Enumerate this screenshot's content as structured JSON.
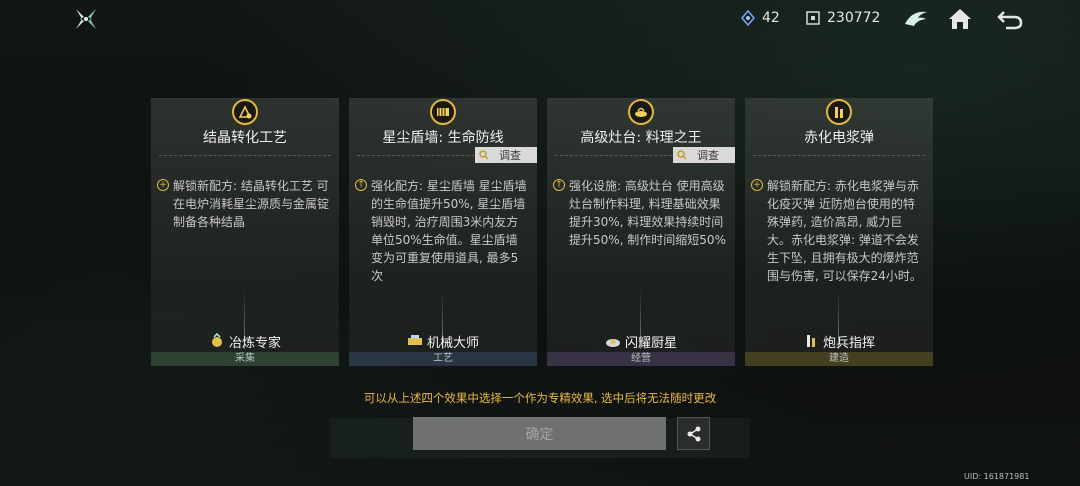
{
  "top_bar": {
    "crystal_count": "42",
    "coin_count": "230772",
    "icons": [
      "logo-icon",
      "crystal-icon",
      "coin-icon",
      "wing-icon",
      "home-icon",
      "back-icon"
    ]
  },
  "cards": [
    {
      "title": "结晶转化工艺",
      "emblem": "crystal-process-icon",
      "description": "解锁新配方: 结晶转化工艺 可在电炉消耗星尘源质与金属锭制备各种结晶",
      "specialty": "冶炼专家",
      "category": "采集"
    },
    {
      "title": "星尘盾墙: 生命防线",
      "emblem": "shield-wall-icon",
      "inspect_label": "调查",
      "description": "强化配方: 星尘盾墙 星尘盾墙的生命值提升50%, 星尘盾墙销毁时, 治疗周围3米内友方单位50%生命值。星尘盾墙变为可重复使用道具, 最多5次",
      "specialty": "机械大师",
      "category": "工艺"
    },
    {
      "title": "高级灶台: 料理之王",
      "emblem": "stove-icon",
      "inspect_label": "调查",
      "description": "强化设施: 高级灶台 使用高级灶台制作料理, 料理基础效果提升30%, 料理效果持续时间提升50%, 制作时间缩短50%",
      "specialty": "闪耀厨星",
      "category": "经营"
    },
    {
      "title": "赤化电浆弹",
      "emblem": "plasma-shell-icon",
      "description": "解锁新配方: 赤化电浆弹与赤化疫灭弹 近防炮台使用的特殊弹药, 造价高昂, 威力巨大。赤化电浆弹: 弹道不会发生下坠, 且拥有极大的爆炸范围与伤害, 可以保存24小时。",
      "specialty": "炮兵指挥",
      "category": "建造"
    }
  ],
  "hint": "可以从上述四个效果中选择一个作为专精效果, 选中后将无法随时更改",
  "confirm_label": "确定",
  "uid": "UID: 161871981",
  "colors": {
    "accent": "#e0b840",
    "hint": "#e8b848",
    "button": "#6f716f"
  }
}
